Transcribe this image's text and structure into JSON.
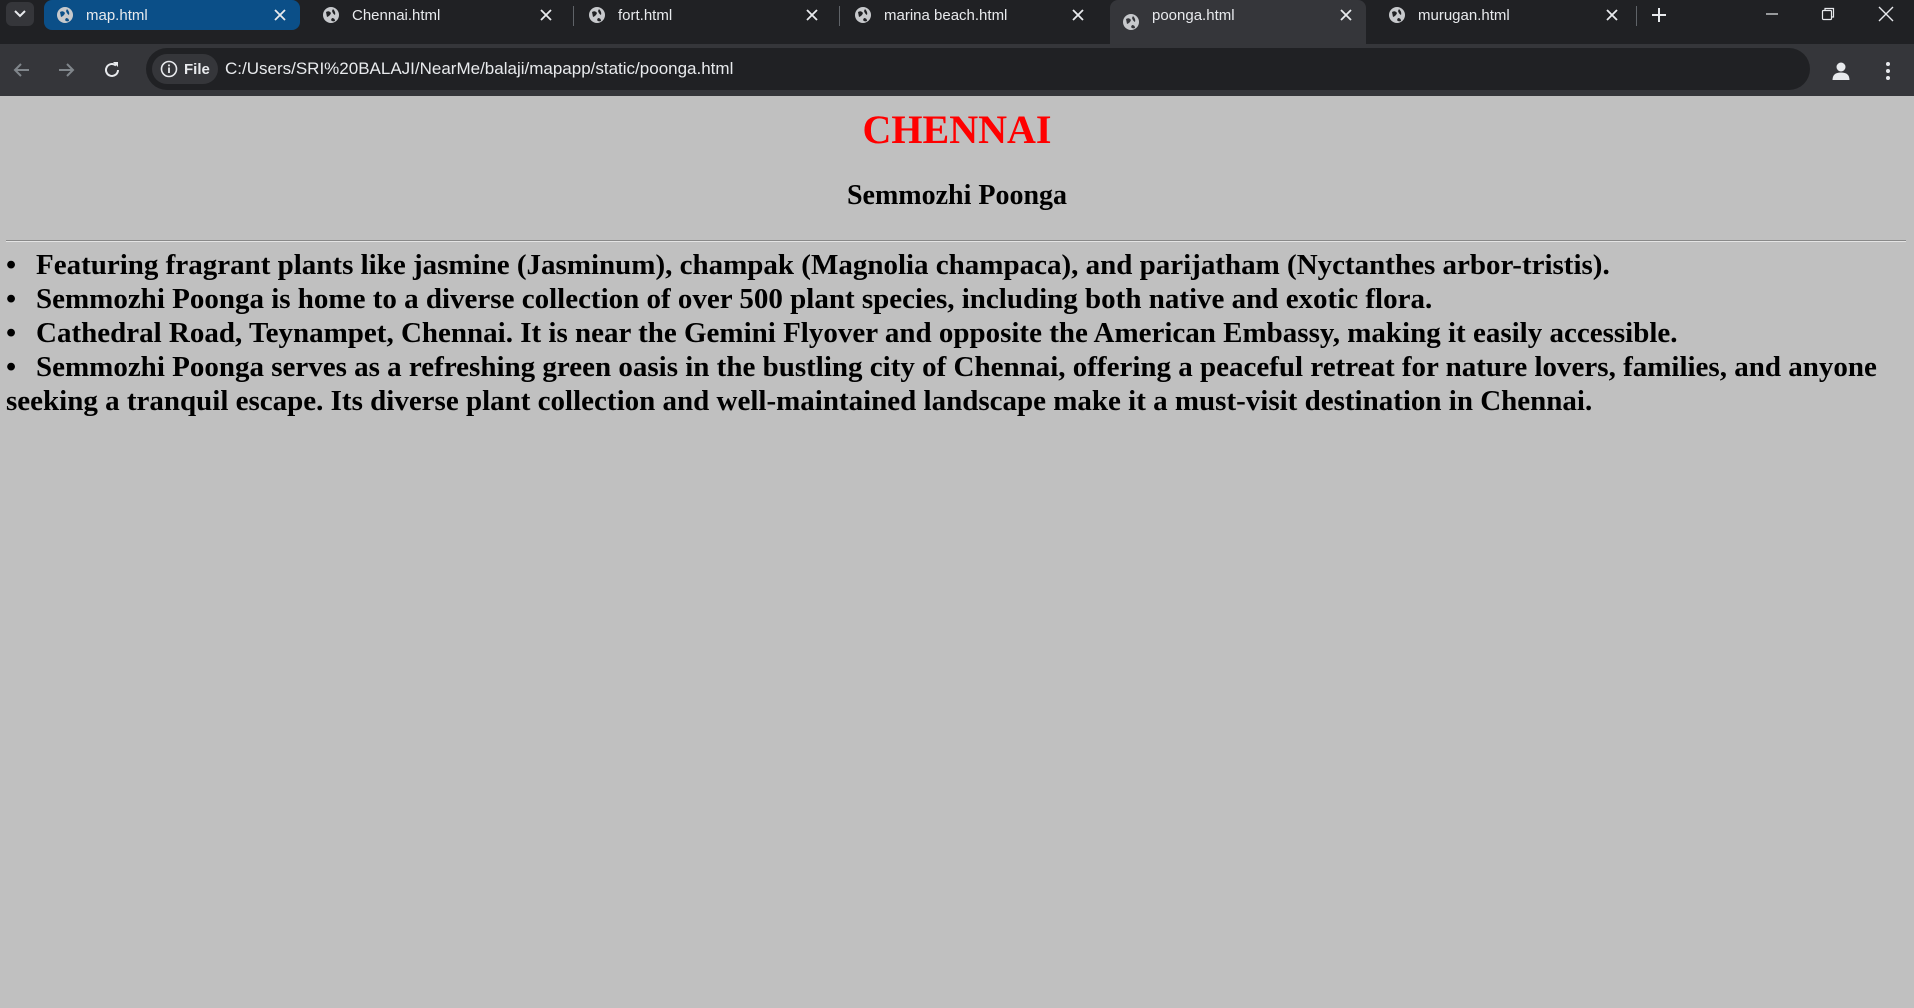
{
  "browser": {
    "tabs": [
      {
        "title": "map.html"
      },
      {
        "title": "Chennai.html"
      },
      {
        "title": "fort.html"
      },
      {
        "title": "marina beach.html"
      },
      {
        "title": "poonga.html"
      },
      {
        "title": "murugan.html"
      }
    ],
    "active_tab": "poonga.html",
    "address": {
      "scheme_chip": "File",
      "url": "C:/Users/SRI%20BALAJI/NearMe/balaji/mapapp/static/poonga.html"
    },
    "colors": {
      "tabstrip": "#202124",
      "toolbar": "#35363a",
      "highlighted_tab": "#0b4f88",
      "text": "#e8eaed"
    }
  },
  "page": {
    "heading": "CHENNAI",
    "subheading": "Semmozhi Poonga",
    "bullets": [
      "Featuring fragrant plants like jasmine (Jasminum), champak (Magnolia champaca), and parijatham (Nyctanthes arbor-tristis).",
      "Semmozhi Poonga is home to a diverse collection of over 500 plant species, including both native and exotic flora.",
      "Cathedral Road, Teynampet, Chennai. It is near the Gemini Flyover and opposite the American Embassy, making it easily accessible.",
      "Semmozhi Poonga serves as a refreshing green oasis in the bustling city of Chennai, offering a peaceful retreat for nature lovers, families, and anyone seeking a tranquil escape. Its diverse plant collection and well-maintained landscape make it a must-visit destination in Chennai."
    ],
    "colors": {
      "background": "#c0c0c0",
      "heading": "#ff0000",
      "text": "#000000"
    }
  }
}
